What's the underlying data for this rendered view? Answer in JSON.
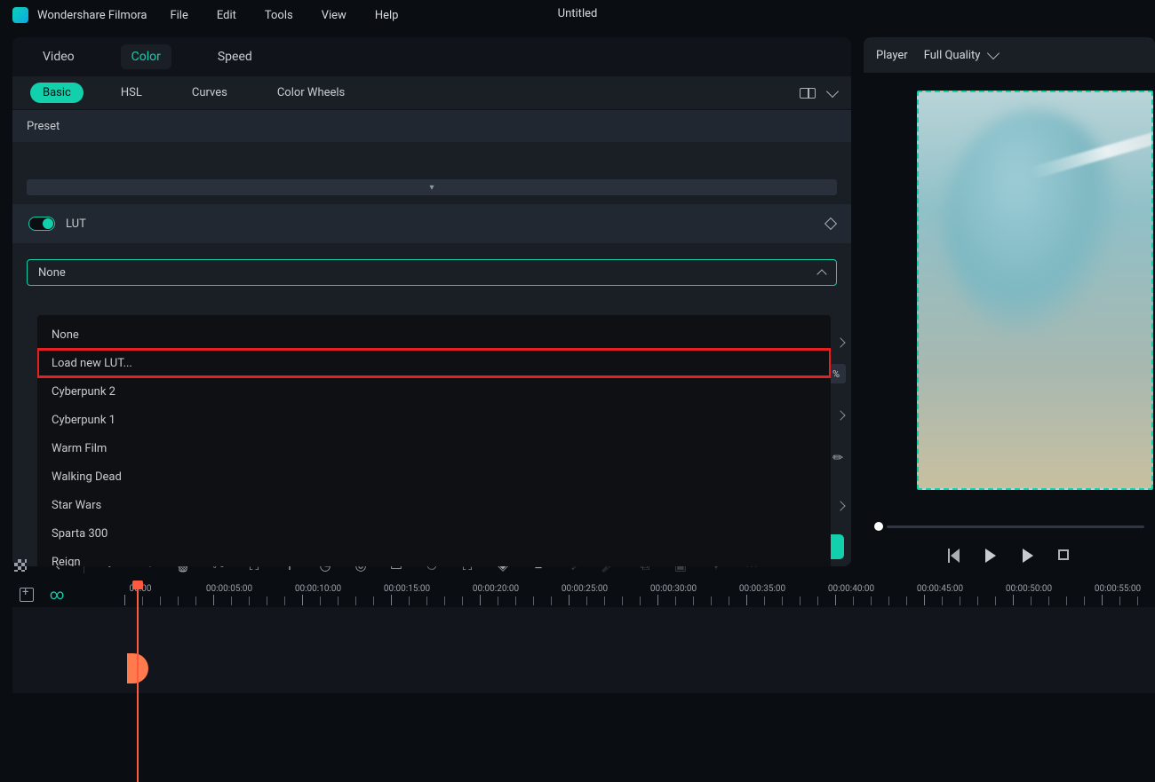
{
  "app_name": "Wondershare Filmora",
  "menu": [
    "File",
    "Edit",
    "Tools",
    "View",
    "Help"
  ],
  "doc_title": "Untitled",
  "tabs_main": [
    "Video",
    "Color",
    "Speed"
  ],
  "tabs_main_active": 1,
  "tabs_color": [
    "Basic",
    "HSL",
    "Curves",
    "Color Wheels"
  ],
  "tabs_color_active": 0,
  "preset_label": "Preset",
  "lut_label": "LUT",
  "lut_selected": "None",
  "lut_options": [
    "None",
    "Load new LUT...",
    "Cyberpunk 2",
    "Cyberpunk 1",
    "Warm Film",
    "Walking Dead",
    "Star Wars",
    "Sparta 300",
    "Reign"
  ],
  "lut_highlight_index": 1,
  "percent_symbol": "%",
  "player_label": "Player",
  "quality_label": "Full Quality",
  "timeline_labels": [
    "00:00",
    "00:00:05:00",
    "00:00:10:00",
    "00:00:15:00",
    "00:00:20:00",
    "00:00:25:00",
    "00:00:30:00",
    "00:00:35:00",
    "00:00:40:00",
    "00:00:45:00",
    "00:00:50:00",
    "00:00:55:00"
  ],
  "collapse_glyph": "▾"
}
